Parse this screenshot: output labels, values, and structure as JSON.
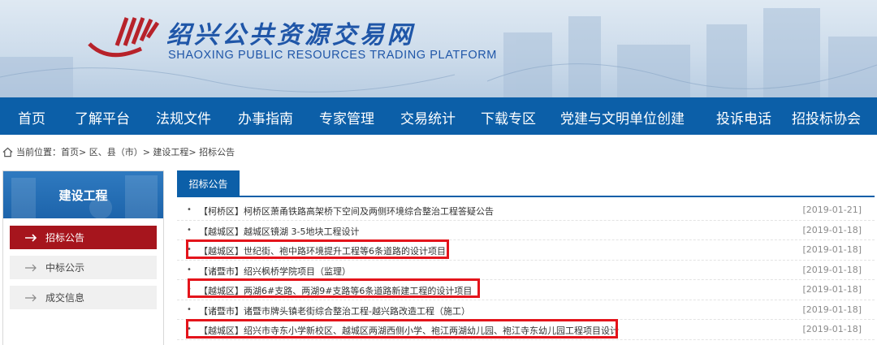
{
  "header": {
    "title_cn": "绍兴公共资源交易网",
    "title_en": "SHAOXING PUBLIC RESOURCES TRADING PLATFORM"
  },
  "nav": {
    "items": [
      "首页",
      "了解平台",
      "法规文件",
      "办事指南",
      "专家管理",
      "交易统计",
      "下载专区",
      "党建与文明单位创建",
      "投诉电话",
      "招投标协会"
    ]
  },
  "breadcrumb": {
    "text": "当前位置：首页> 区、县（市）> 建设工程> 招标公告"
  },
  "sidebar": {
    "heading": "建设工程",
    "items": [
      {
        "label": "招标公告",
        "active": true
      },
      {
        "label": "中标公示",
        "active": false
      },
      {
        "label": "成交信息",
        "active": false
      }
    ]
  },
  "main": {
    "tab_label": "招标公告",
    "rows": [
      {
        "title": "【柯桥区】柯桥区萧甬铁路高架桥下空间及两侧环境综合整治工程答疑公告",
        "date": "[2019-01-21]",
        "highlighted": false
      },
      {
        "title": "【越城区】越城区镜湖 3-5地块工程设计",
        "date": "[2019-01-18]",
        "highlighted": false
      },
      {
        "title": "【越城区】世纪街、袍中路环境提升工程等6条道路的设计项目",
        "date": "[2019-01-18]",
        "highlighted": true
      },
      {
        "title": "【诸暨市】绍兴枫桥学院项目（监理）",
        "date": "[2019-01-18]",
        "highlighted": false
      },
      {
        "title": "【越城区】两湖6#支路、两湖9#支路等6条道路新建工程的设计项目",
        "date": "[2019-01-18]",
        "highlighted": true
      },
      {
        "title": "【诸暨市】诸暨市牌头镇老街综合整治工程-越兴路改造工程（施工）",
        "date": "[2019-01-18]",
        "highlighted": false
      },
      {
        "title": "【越城区】绍兴市寺东小学新校区、越城区两湖西侧小学、袍江两湖幼儿园、袍江寺东幼儿园工程项目设计",
        "date": "[2019-01-18]",
        "highlighted": true
      }
    ]
  },
  "colors": {
    "nav_bg": "#0c5fa8",
    "active_side": "#a6151d",
    "highlight_border": "#e4141b",
    "brand_blue": "#1f56a8"
  }
}
